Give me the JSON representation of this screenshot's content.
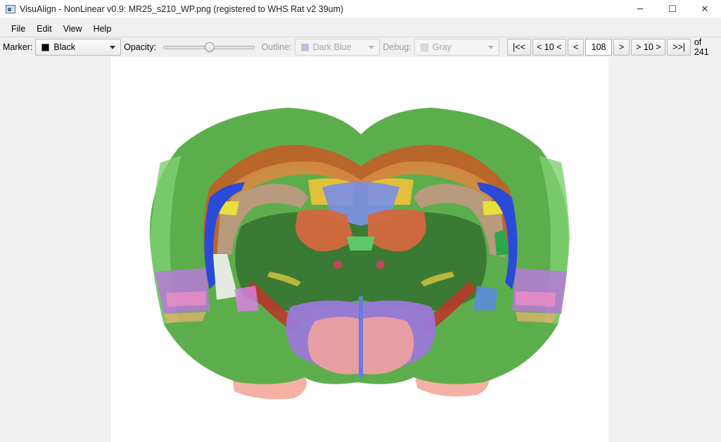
{
  "window": {
    "title": "VisuAlign - NonLinear v0.9: MR25_s210_WP.png (registered to WHS Rat v2 39um)",
    "minimize_glyph": "─",
    "maximize_glyph": "☐",
    "close_glyph": "✕"
  },
  "menu": {
    "items": [
      "File",
      "Edit",
      "View",
      "Help"
    ]
  },
  "toolbar": {
    "marker_label": "Marker:",
    "marker_value": "Black",
    "marker_color": "#000000",
    "opacity_label": "Opacity:",
    "opacity_value": 0.5,
    "outline_label": "Outline:",
    "outline_value": "Dark Blue",
    "outline_color": "#b8bfe6",
    "debug_label": "Debug:",
    "debug_value": "Gray",
    "debug_color": "#dcdcdc",
    "nav": {
      "first": "|<<",
      "back10": "< 10 <",
      "prev": "<",
      "page": "108",
      "next": ">",
      "fwd10": "> 10 >",
      "last": ">>|",
      "total": "of 241"
    },
    "annotation_color": "#d11a1a"
  },
  "icons": {
    "app": "app-icon",
    "dropdown": "chevron-down-icon"
  }
}
